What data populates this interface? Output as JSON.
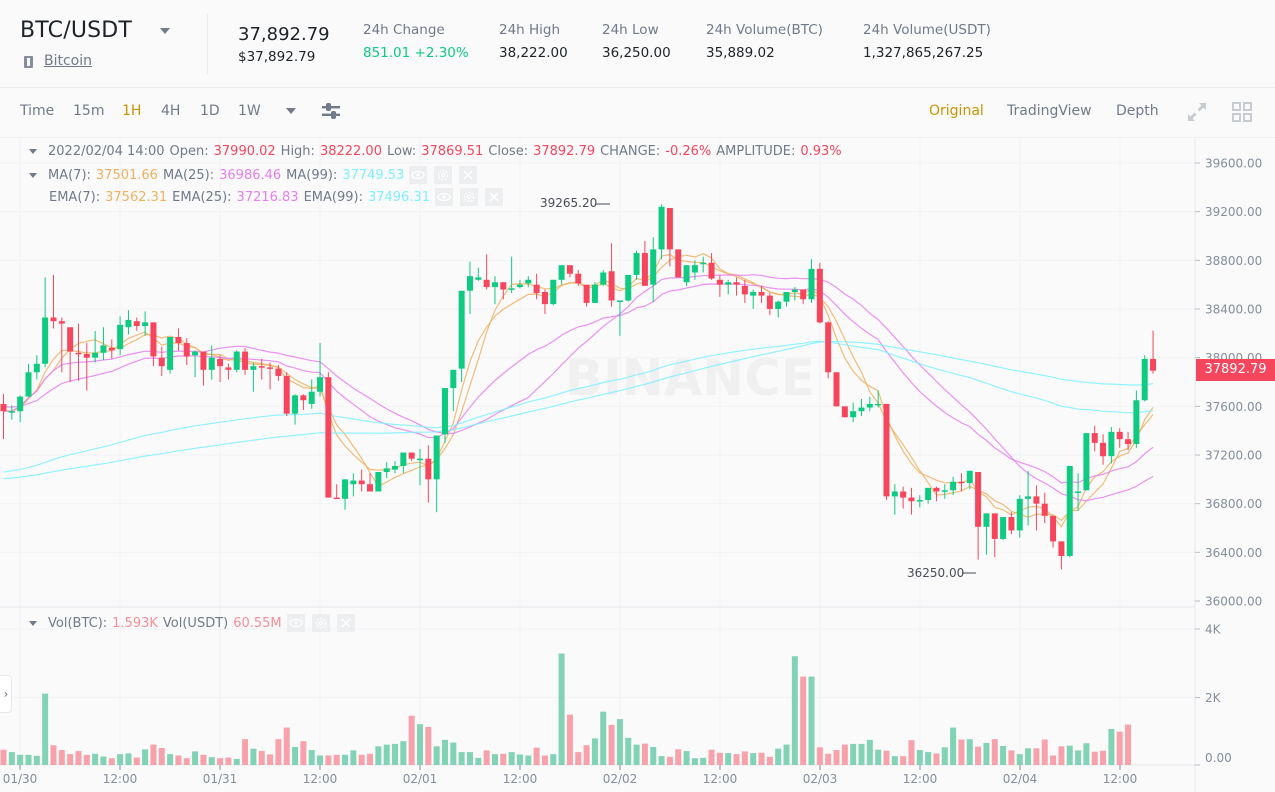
{
  "header": {
    "symbol": "BTC/USDT",
    "coin_name": "Bitcoin",
    "last_price": "37,892.79",
    "last_price_usd": "$37,892.79",
    "stats": [
      {
        "label": "24h Change",
        "value": "851.01 +2.30%",
        "positive": true
      },
      {
        "label": "24h High",
        "value": "38,222.00"
      },
      {
        "label": "24h Low",
        "value": "36,250.00"
      },
      {
        "label": "24h Volume(BTC)",
        "value": "35,889.02"
      },
      {
        "label": "24h Volume(USDT)",
        "value": "1,327,865,267.25"
      }
    ]
  },
  "toolbar": {
    "intervals": [
      "Time",
      "15m",
      "1H",
      "4H",
      "1D",
      "1W"
    ],
    "active_interval": "1H",
    "views": [
      "Original",
      "TradingView",
      "Depth"
    ],
    "active_view": "Original"
  },
  "legend": {
    "ohlc": {
      "date": "2022/02/04 14:00",
      "open_label": "Open:",
      "open": "37990.02",
      "high_label": "High:",
      "high": "38222.00",
      "low_label": "Low:",
      "low": "37869.51",
      "close_label": "Close:",
      "close": "37892.79",
      "change_label": "CHANGE:",
      "change": "-0.26%",
      "amplitude_label": "AMPLITUDE:",
      "amplitude": "0.93%"
    },
    "ma": [
      {
        "label": "MA(7):",
        "value": "37501.66",
        "color": "#f0b060"
      },
      {
        "label": "MA(25):",
        "value": "36986.46",
        "color": "#e77ef0"
      },
      {
        "label": "MA(99):",
        "value": "37749.53",
        "color": "#7ff0ff"
      }
    ],
    "ema": [
      {
        "label": "EMA(7):",
        "value": "37562.31",
        "color": "#f0b060"
      },
      {
        "label": "EMA(25):",
        "value": "37216.83",
        "color": "#e77ef0"
      },
      {
        "label": "EMA(99):",
        "value": "37496.31",
        "color": "#7ff0ff"
      }
    ],
    "volume": [
      {
        "label": "Vol(BTC):",
        "value": "1.593K"
      },
      {
        "label": "Vol(USDT)",
        "value": "60.55M"
      }
    ]
  },
  "price_tag": "37892.79",
  "watermark": "BINANCE",
  "nav_handle": "›",
  "chart_data": {
    "type": "candlestick",
    "title": "BTC/USDT 1H",
    "interval": "1H",
    "price_axis": {
      "ticks": [
        "39600.00",
        "39200.00",
        "38800.00",
        "38400.00",
        "38000.00",
        "37600.00",
        "37200.00",
        "36800.00",
        "36400.00",
        "36000.00"
      ],
      "range": [
        36000,
        39600
      ]
    },
    "volume_axis": {
      "ticks": [
        "4K",
        "2K",
        "0.00"
      ],
      "range": [
        0,
        4000
      ]
    },
    "x_ticks": [
      "01/30",
      "12:00",
      "01/31",
      "12:00",
      "02/01",
      "12:00",
      "02/02",
      "12:00",
      "02/03",
      "12:00",
      "02/04",
      "12:00"
    ],
    "annotations": {
      "max_label": "39265.20",
      "min_label": "36250.00"
    },
    "colors": {
      "up": "#0ecb81",
      "down": "#f6465d",
      "ma7": "#f0b060",
      "ma25": "#e77ef0",
      "ma99": "#7ff0ff"
    },
    "candles": [
      [
        37620,
        37700,
        37330,
        37560
      ],
      [
        37560,
        37610,
        37490,
        37560
      ],
      [
        37560,
        37690,
        37470,
        37680
      ],
      [
        37680,
        37950,
        37680,
        37880
      ],
      [
        37880,
        38020,
        37820,
        37950
      ],
      [
        37950,
        38660,
        37920,
        38330
      ],
      [
        38330,
        38680,
        38240,
        38300
      ],
      [
        38300,
        38330,
        37880,
        38280
      ],
      [
        38250,
        38210,
        37800,
        38050
      ],
      [
        38040,
        38280,
        37810,
        38030
      ],
      [
        38030,
        38120,
        37730,
        38000
      ],
      [
        38000,
        38220,
        37960,
        38040
      ],
      [
        38040,
        38250,
        37980,
        38100
      ],
      [
        38080,
        38150,
        37990,
        38060
      ],
      [
        38070,
        38340,
        38020,
        38270
      ],
      [
        38250,
        38390,
        38190,
        38310
      ],
      [
        38300,
        38330,
        38220,
        38260
      ],
      [
        38260,
        38380,
        38180,
        38290
      ],
      [
        38290,
        38280,
        37930,
        38010
      ],
      [
        38000,
        38090,
        37850,
        37930
      ],
      [
        37900,
        38170,
        37870,
        38170
      ],
      [
        38170,
        38240,
        38060,
        38120
      ],
      [
        38120,
        38160,
        37940,
        38010
      ],
      [
        38020,
        38060,
        37840,
        38050
      ],
      [
        38050,
        38050,
        37770,
        37900
      ],
      [
        37900,
        38100,
        37820,
        38000
      ],
      [
        37990,
        38020,
        37800,
        37930
      ],
      [
        37920,
        37950,
        37820,
        37900
      ],
      [
        37900,
        38060,
        37880,
        38050
      ],
      [
        38050,
        38080,
        37860,
        37900
      ],
      [
        37900,
        37960,
        37720,
        37930
      ],
      [
        37930,
        37990,
        37820,
        37920
      ],
      [
        37920,
        37960,
        37740,
        37910
      ],
      [
        37910,
        37940,
        37810,
        37850
      ],
      [
        37850,
        37880,
        37520,
        37540
      ],
      [
        37540,
        37700,
        37450,
        37690
      ],
      [
        37690,
        37700,
        37570,
        37650
      ],
      [
        37620,
        37820,
        37580,
        37720
      ],
      [
        37720,
        38120,
        37680,
        37840
      ],
      [
        37840,
        37880,
        36880,
        36850
      ],
      [
        36850,
        36960,
        36840,
        36840
      ],
      [
        36840,
        36860,
        36750,
        37000
      ],
      [
        36960,
        37050,
        36860,
        36990
      ],
      [
        36990,
        37080,
        36900,
        36960
      ],
      [
        36960,
        37050,
        36920,
        36900
      ],
      [
        36900,
        37060,
        36920,
        37060
      ],
      [
        37060,
        37140,
        37010,
        37090
      ],
      [
        37080,
        37150,
        37050,
        37110
      ],
      [
        37110,
        37200,
        37050,
        37220
      ],
      [
        37220,
        37220,
        37150,
        37170
      ],
      [
        37170,
        37250,
        36950,
        37170
      ],
      [
        37170,
        37280,
        36810,
        37000
      ],
      [
        37000,
        37300,
        36730,
        37360
      ],
      [
        37370,
        37650,
        37300,
        37750
      ],
      [
        37750,
        37900,
        37560,
        37900
      ],
      [
        37910,
        38400,
        37800,
        38550
      ],
      [
        38550,
        38790,
        38360,
        38670
      ],
      [
        38640,
        38740,
        38630,
        38660
      ],
      [
        38640,
        38850,
        38560,
        38580
      ],
      [
        38580,
        38670,
        38440,
        38620
      ],
      [
        38620,
        38580,
        38480,
        38560
      ],
      [
        38570,
        38830,
        38530,
        38570
      ],
      [
        38580,
        38640,
        38570,
        38600
      ],
      [
        38610,
        38670,
        38580,
        38640
      ],
      [
        38600,
        38690,
        38480,
        38530
      ],
      [
        38540,
        38560,
        38360,
        38440
      ],
      [
        38440,
        38640,
        38430,
        38640
      ],
      [
        38640,
        38760,
        38600,
        38760
      ],
      [
        38760,
        38750,
        38660,
        38690
      ],
      [
        38690,
        38720,
        38590,
        38610
      ],
      [
        38600,
        38580,
        38420,
        38450
      ],
      [
        38450,
        38620,
        38470,
        38600
      ],
      [
        38600,
        38720,
        38590,
        38700
      ],
      [
        38710,
        38940,
        38420,
        38470
      ],
      [
        38460,
        38470,
        38180,
        38470
      ],
      [
        38470,
        38670,
        38460,
        38680
      ],
      [
        38680,
        38880,
        38640,
        38860
      ],
      [
        38860,
        38960,
        38600,
        38590
      ],
      [
        38600,
        38990,
        38460,
        38890
      ],
      [
        38890,
        39260,
        38810,
        39240
      ],
      [
        39230,
        39180,
        38750,
        38890
      ],
      [
        38890,
        38890,
        38660,
        38660
      ],
      [
        38620,
        38760,
        38590,
        38760
      ],
      [
        38700,
        38800,
        38640,
        38760
      ],
      [
        38780,
        38830,
        38700,
        38780
      ],
      [
        38780,
        38860,
        38640,
        38650
      ],
      [
        38640,
        38680,
        38500,
        38600
      ],
      [
        38600,
        38640,
        38520,
        38620
      ],
      [
        38620,
        38660,
        38510,
        38600
      ],
      [
        38590,
        38640,
        38450,
        38520
      ],
      [
        38510,
        38560,
        38400,
        38540
      ],
      [
        38540,
        38590,
        38450,
        38510
      ],
      [
        38510,
        38530,
        38350,
        38400
      ],
      [
        38400,
        38470,
        38330,
        38460
      ],
      [
        38460,
        38540,
        38420,
        38540
      ],
      [
        38540,
        38580,
        38470,
        38560
      ],
      [
        38560,
        38560,
        38440,
        38480
      ],
      [
        38480,
        38810,
        38450,
        38730
      ],
      [
        38730,
        38780,
        38280,
        38290
      ],
      [
        38290,
        38300,
        37830,
        37880
      ],
      [
        37880,
        37880,
        37600,
        37600
      ],
      [
        37600,
        37560,
        37520,
        37510
      ],
      [
        37510,
        37630,
        37470,
        37560
      ],
      [
        37560,
        37660,
        37520,
        37590
      ],
      [
        37590,
        37680,
        37560,
        37620
      ],
      [
        37620,
        37730,
        37590,
        37620
      ],
      [
        37620,
        37550,
        36830,
        36860
      ],
      [
        36860,
        36960,
        36710,
        36900
      ],
      [
        36900,
        36940,
        36760,
        36850
      ],
      [
        36850,
        36930,
        36710,
        36820
      ],
      [
        36820,
        36870,
        36770,
        36830
      ],
      [
        36830,
        36930,
        36800,
        36930
      ],
      [
        36930,
        36940,
        36820,
        36900
      ],
      [
        36900,
        36960,
        36840,
        36910
      ],
      [
        36910,
        37020,
        36870,
        36980
      ],
      [
        36980,
        37050,
        36900,
        36970
      ],
      [
        36970,
        37060,
        36920,
        37070
      ],
      [
        37060,
        36600,
        36340,
        36610
      ],
      [
        36610,
        36620,
        36380,
        36720
      ],
      [
        36720,
        36620,
        36360,
        36510
      ],
      [
        36510,
        36680,
        36500,
        36690
      ],
      [
        36690,
        36730,
        36550,
        36580
      ],
      [
        36580,
        36870,
        36520,
        36840
      ],
      [
        36840,
        37070,
        36620,
        36860
      ],
      [
        36860,
        36950,
        36580,
        36800
      ],
      [
        36800,
        36890,
        36640,
        36700
      ],
      [
        36700,
        36680,
        36440,
        36490
      ],
      [
        36490,
        36380,
        36260,
        36370
      ],
      [
        36370,
        37090,
        36360,
        37110
      ],
      [
        36900,
        37050,
        36740,
        36900
      ],
      [
        36910,
        37330,
        36930,
        37380
      ],
      [
        37380,
        37440,
        37230,
        37300
      ],
      [
        37300,
        37370,
        37120,
        37190
      ],
      [
        37190,
        37430,
        37130,
        37390
      ],
      [
        37390,
        37420,
        37260,
        37330
      ],
      [
        37330,
        37390,
        37240,
        37290
      ],
      [
        37290,
        37730,
        37260,
        37650
      ],
      [
        37650,
        38020,
        37640,
        37990
      ],
      [
        37990,
        38222,
        37869,
        37893
      ]
    ],
    "volumes_k": [
      0.45,
      0.38,
      0.3,
      0.3,
      0.27,
      2.1,
      0.58,
      0.44,
      0.32,
      0.41,
      0.3,
      0.33,
      0.25,
      0.2,
      0.32,
      0.34,
      0.22,
      0.46,
      0.6,
      0.5,
      0.32,
      0.28,
      0.2,
      0.4,
      0.3,
      0.23,
      0.2,
      0.22,
      0.18,
      0.76,
      0.48,
      0.41,
      0.31,
      0.76,
      1.1,
      0.53,
      0.7,
      0.44,
      0.28,
      0.28,
      0.3,
      0.3,
      0.43,
      0.3,
      0.33,
      0.55,
      0.6,
      0.62,
      0.7,
      1.45,
      1.2,
      1.12,
      0.55,
      0.74,
      0.66,
      0.38,
      0.38,
      0.21,
      0.43,
      0.32,
      0.33,
      0.38,
      0.31,
      0.28,
      0.51,
      0.28,
      0.32,
      3.28,
      1.48,
      0.38,
      0.58,
      0.78,
      1.57,
      1.18,
      1.35,
      0.8,
      0.6,
      0.63,
      0.53,
      0.26,
      0.24,
      0.46,
      0.41,
      0.2,
      0.21,
      0.45,
      0.36,
      0.35,
      0.32,
      0.4,
      0.35,
      0.36,
      0.24,
      0.48,
      0.6,
      3.2,
      2.6,
      2.6,
      0.52,
      0.33,
      0.44,
      0.6,
      0.62,
      0.62,
      0.74,
      0.45,
      0.42,
      0.26,
      0.26,
      0.73,
      0.44,
      0.38,
      0.34,
      0.52,
      1.1,
      0.75,
      0.76,
      0.54,
      0.65,
      0.76,
      0.56,
      0.43,
      0.32,
      0.49,
      0.49,
      0.75,
      0.28,
      0.55,
      0.57,
      0.43,
      0.64,
      0.39,
      0.42,
      1.06,
      0.98,
      1.19
    ]
  }
}
